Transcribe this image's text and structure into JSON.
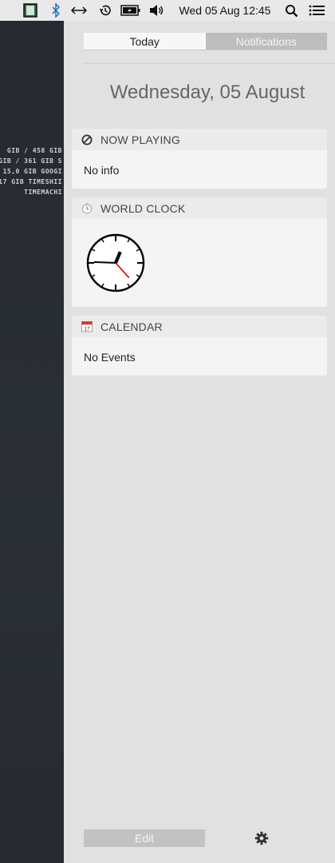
{
  "menubar": {
    "clock": "Wed 05 Aug  12:45",
    "icons": [
      "app-icon",
      "bluetooth-icon",
      "network-icon",
      "time-machine-icon",
      "battery-icon",
      "volume-icon",
      "spotlight-search-icon",
      "notification-center-icon"
    ]
  },
  "desktop": {
    "disk_lines": [
      "GIB / 458 GIB",
      "GIB / 361 GIB S",
      "15,0 GIB GOOGI",
      "17 GIB TIMESHII",
      "TIMEMACHI"
    ]
  },
  "panel": {
    "tabs": [
      {
        "label": "Today",
        "active": true
      },
      {
        "label": "Notifications",
        "active": false
      }
    ],
    "date": "Wednesday, 05 August",
    "widgets": {
      "now_playing": {
        "title": "NOW PLAYING",
        "body": "No info",
        "icon": "no-entry-icon"
      },
      "world_clock": {
        "title": "WORLD CLOCK",
        "icon": "clock-icon",
        "time": "12:45:23"
      },
      "calendar": {
        "title": "CALENDAR",
        "body": "No Events",
        "icon": "calendar-icon",
        "icon_day": "17"
      }
    },
    "edit_label": "Edit",
    "settings_icon": "gear-icon"
  },
  "colors": {
    "panel_bg": "#e1e1e1",
    "widget_bg": "#f4f4f4",
    "widget_header_bg": "#ebebeb",
    "tab_active_bg": "#f7f7f7",
    "tab_inactive_bg": "#bdbdbd",
    "second_hand": "#d40000",
    "bluetooth": "#1f6fd1",
    "calendar_red": "#e0332b"
  }
}
